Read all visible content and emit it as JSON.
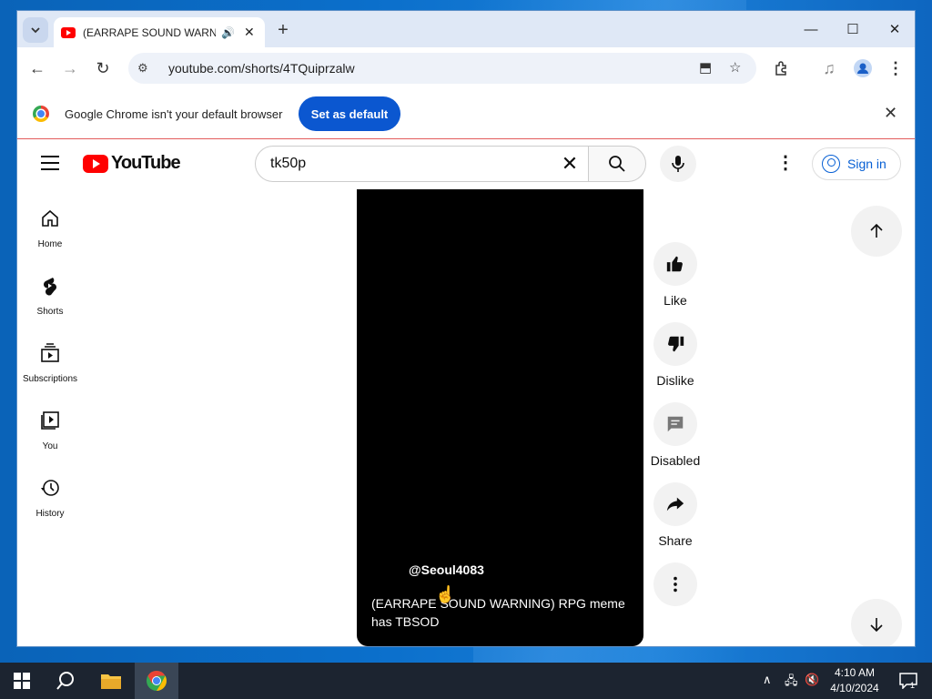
{
  "browser": {
    "tab_title": "(EARRAPE SOUND WARNING) RPG meme has TBSOD",
    "url": "youtube.com/shorts/4TQuiprzalw",
    "infobar_text": "Google Chrome isn't your default browser",
    "set_default_label": "Set as default"
  },
  "youtube": {
    "logo_text": "YouTube",
    "search_value": "tk50p",
    "signin_label": "Sign in",
    "guide": [
      {
        "label": "Home"
      },
      {
        "label": "Shorts"
      },
      {
        "label": "Subscriptions"
      },
      {
        "label": "You"
      },
      {
        "label": "History"
      }
    ],
    "video": {
      "channel": "@Seoul4083",
      "caption": "(EARRAPE SOUND WARNING) RPG meme has TBSOD"
    },
    "actions": [
      {
        "label": "Like",
        "icon": "thumbs-up-icon"
      },
      {
        "label": "Dislike",
        "icon": "thumbs-down-icon"
      },
      {
        "label": "Disabled",
        "icon": "comments-disabled-icon"
      },
      {
        "label": "Share",
        "icon": "share-icon"
      },
      {
        "label": "",
        "icon": "more-vertical-icon"
      }
    ]
  },
  "taskbar": {
    "time": "4:10 AM",
    "date": "4/10/2024",
    "notification_count": "1"
  },
  "colors": {
    "youtube_red": "#ff0000",
    "chrome_blue": "#0b57d0",
    "link_blue": "#065fd4"
  }
}
